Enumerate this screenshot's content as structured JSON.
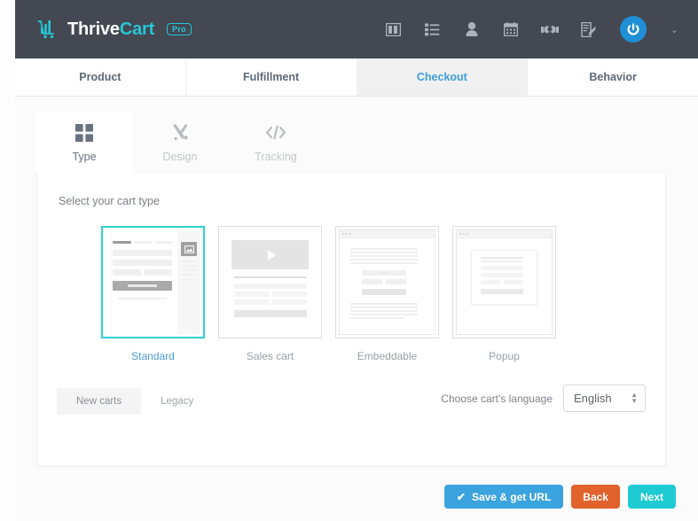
{
  "header": {
    "logo": {
      "part1": "Thrive",
      "part2": "Cart",
      "badge": "Pro"
    },
    "icons": [
      {
        "name": "layout-columns-icon",
        "label": "Dashboard"
      },
      {
        "name": "list-icon",
        "label": "Products"
      },
      {
        "name": "person-icon",
        "label": "Customers"
      },
      {
        "name": "calendar-icon",
        "label": "Calendar"
      },
      {
        "name": "handshake-icon",
        "label": "Affiliates"
      },
      {
        "name": "document-edit-icon",
        "label": "Reports"
      }
    ],
    "avatar": {
      "name": "power-avatar-icon",
      "caret": "⌄"
    }
  },
  "main_tabs": [
    {
      "label": "Product",
      "active": false
    },
    {
      "label": "Fulfillment",
      "active": false
    },
    {
      "label": "Checkout",
      "active": true
    },
    {
      "label": "Behavior",
      "active": false
    }
  ],
  "sub_tabs": [
    {
      "label": "Type",
      "icon": "grid-icon",
      "active": true
    },
    {
      "label": "Design",
      "icon": "brush-icon",
      "active": false
    },
    {
      "label": "Tracking",
      "icon": "code-icon",
      "active": false
    }
  ],
  "panel": {
    "title": "Select your cart type",
    "cart_types": [
      {
        "label": "Standard",
        "selected": true
      },
      {
        "label": "Sales cart",
        "selected": false
      },
      {
        "label": "Embeddable",
        "selected": false
      },
      {
        "label": "Popup",
        "selected": false
      }
    ],
    "segments": [
      {
        "label": "New carts",
        "active": true
      },
      {
        "label": "Legacy",
        "active": false
      }
    ],
    "language": {
      "label": "Choose cart's language",
      "value": "English",
      "options": [
        "English"
      ]
    }
  },
  "footer": {
    "save_label": "Save & get URL",
    "save_check": "✔",
    "back_label": "Back",
    "next_label": "Next"
  },
  "colors": {
    "header_bg": "#434852",
    "brand_teal": "#26c6d4",
    "accent_blue": "#3d9fd8",
    "selected_border": "#2fd0d6",
    "save_blue": "#3ba3dd",
    "back_orange": "#e2622c",
    "next_teal": "#1ecbd2"
  }
}
